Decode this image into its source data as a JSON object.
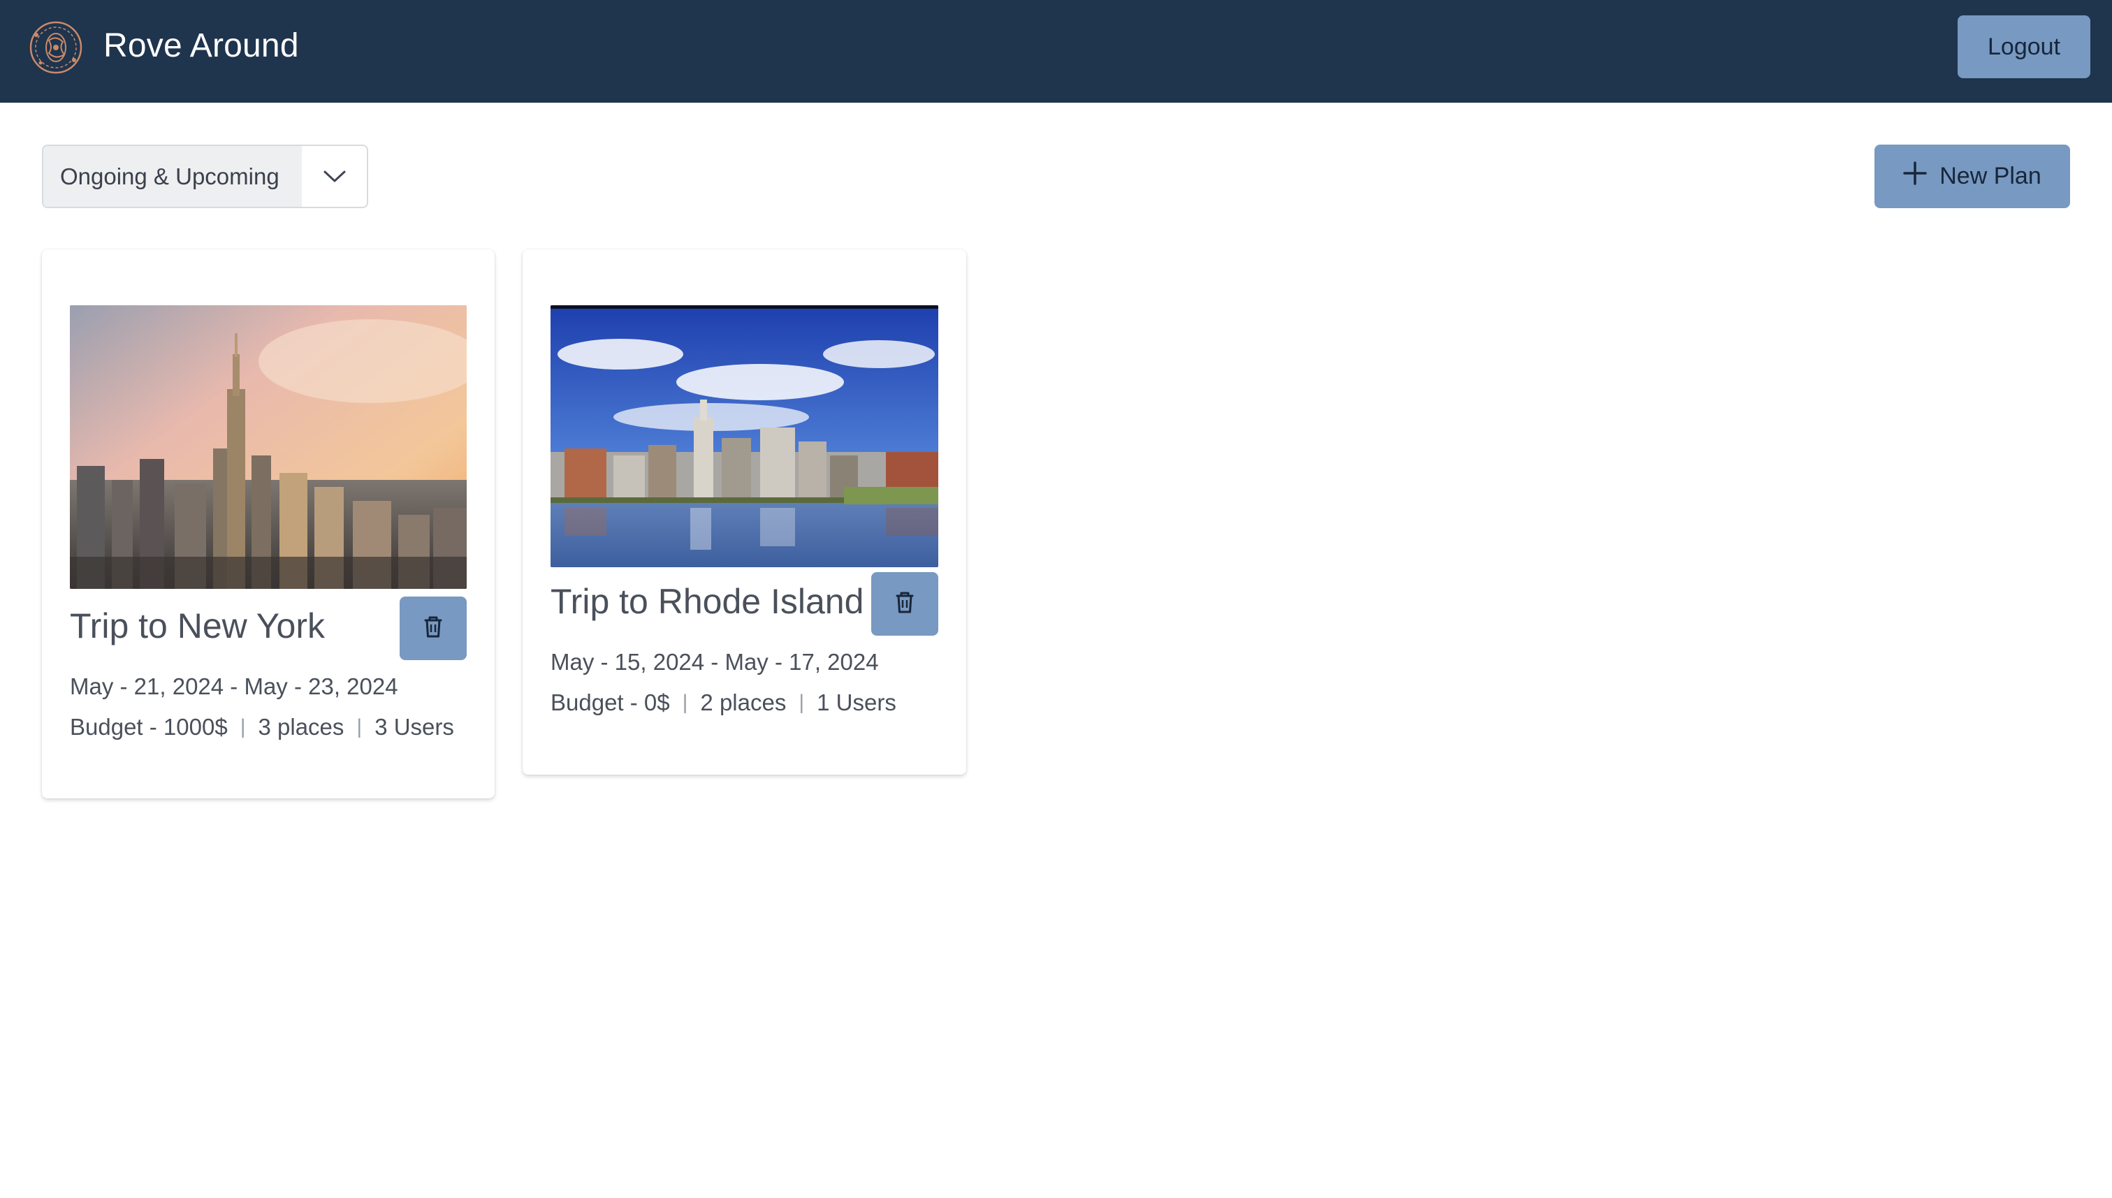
{
  "header": {
    "app_title": "Rove Around",
    "logo_icon": "compass-globe-logo-icon",
    "logout_label": "Logout"
  },
  "toolbar": {
    "filter_selected": "Ongoing & Upcoming",
    "new_plan_label": "New Plan"
  },
  "plans": [
    {
      "title": "Trip to New York",
      "dates": "May - 21, 2024 - May - 23, 2024",
      "budget": "Budget - 1000$",
      "places": "3 places",
      "users": "3 Users",
      "image": "new-york-skyline-photo"
    },
    {
      "title": "Trip to Rhode Island",
      "dates": "May - 15, 2024 - May - 17, 2024",
      "budget": "Budget - 0$",
      "places": "2 places",
      "users": "1 Users",
      "image": "providence-riverfront-photo"
    }
  ],
  "colors": {
    "header_bg": "#1f344d",
    "accent_button": "#7899c1"
  }
}
